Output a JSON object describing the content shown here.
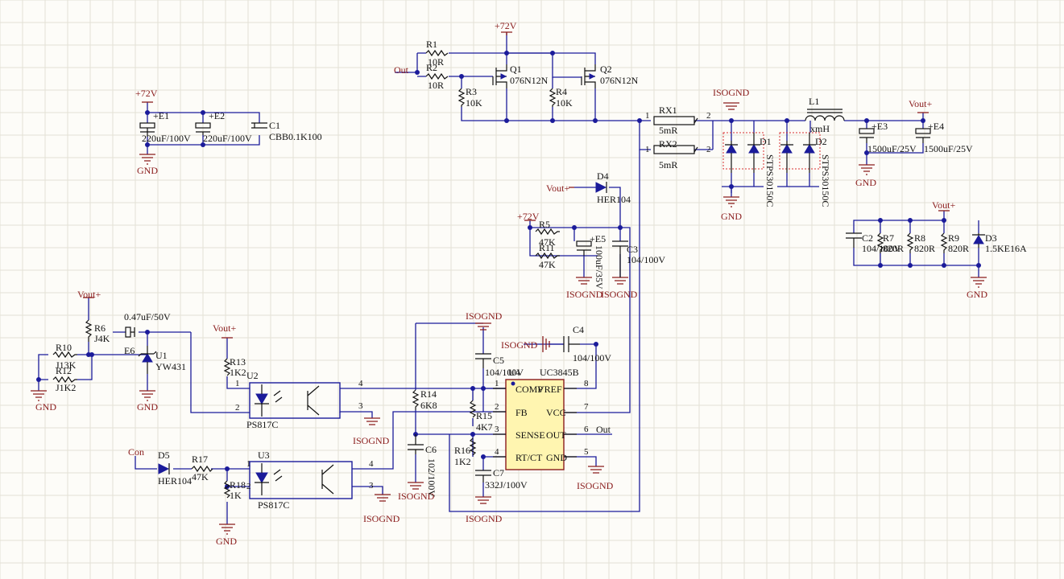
{
  "nets": {
    "v72": "+72V",
    "gnd": "GND",
    "isognd": "ISOGND",
    "vout": "Vout+",
    "out": "Out",
    "con": "Con"
  },
  "parts": {
    "r1": "R1",
    "r1v": "10R",
    "r2": "R2",
    "r2v": "10R",
    "r3": "R3",
    "r3v": "10K",
    "r4": "R4",
    "r4v": "10K",
    "q1": "Q1",
    "q1v": "076N12N",
    "q2": "Q2",
    "q2v": "076N12N",
    "e1": "+E1",
    "e1v": "220uF/100V",
    "e2": "+E2",
    "e2v": "220uF/100V",
    "c1": "C1",
    "c1v": "CBB0.1K100",
    "rx1": "RX1",
    "rx1v": "5mR",
    "rx2": "RX2",
    "rx2v": "5mR",
    "d1": "D1",
    "d1v": "STPS30150C",
    "d2": "D2",
    "d2v": "STPS30150C",
    "l1": "L1",
    "l1v": "xmH",
    "e3": "+E3",
    "e3v": "1500uF/25V",
    "e4": "+E4",
    "e4v": "1500uF/25V",
    "d4": "D4",
    "d4v": "HER104",
    "r5": "R5",
    "r5v": "47K",
    "r11": "R11",
    "r11v": "47K",
    "e5": "+E5",
    "e5v": "100uF/35V",
    "c3": "C3",
    "c3v": "104/100V",
    "c2": "C2",
    "c2v": "104/100V",
    "r7": "R7",
    "r7v": "820R",
    "r8": "R8",
    "r8v": "820R",
    "r9": "R9",
    "r9v": "820R",
    "d3": "D3",
    "d3v": "1.5KE16A",
    "r6": "R6",
    "r6v": "J4K",
    "r10": "R10",
    "r10v": "J13K",
    "r12": "R12",
    "r12v": "J1K2",
    "e6": "E6",
    "e6v": "0.47uF/50V",
    "u1": "U1",
    "u1v": "YW431",
    "r13": "R13",
    "r13v": "1K2",
    "u2": "U2",
    "u2v": "PS817C",
    "u3": "U3",
    "u3v": "PS817C",
    "d5": "D5",
    "d5v": "HER104",
    "r17": "R17",
    "r17v": "47K",
    "r18": "R18",
    "r18v": "1K",
    "r14": "R14",
    "r14v": "6K8",
    "r15": "R15",
    "r15v": "4K7",
    "r16": "R16",
    "r16v": "1K2",
    "c4": "C4",
    "c4v": "104/100V",
    "c5": "C5",
    "c5v": "104/100V",
    "c6": "C6",
    "c6v": "102/100V",
    "c7": "C7",
    "c7v": "332J/100V",
    "u4": "U4",
    "u4v": "UC3845B"
  },
  "ic": {
    "comp": "COMP",
    "vref": "VREF",
    "fb": "FB",
    "vcc": "VCC",
    "sense": "SENSE",
    "out": "OUT",
    "rtct": "RT/CT",
    "gnd": "GND"
  },
  "pins": {
    "p1": "1",
    "p2": "2",
    "p3": "3",
    "p4": "4",
    "p5": "5",
    "p6": "6",
    "p7": "7",
    "p8": "8"
  }
}
